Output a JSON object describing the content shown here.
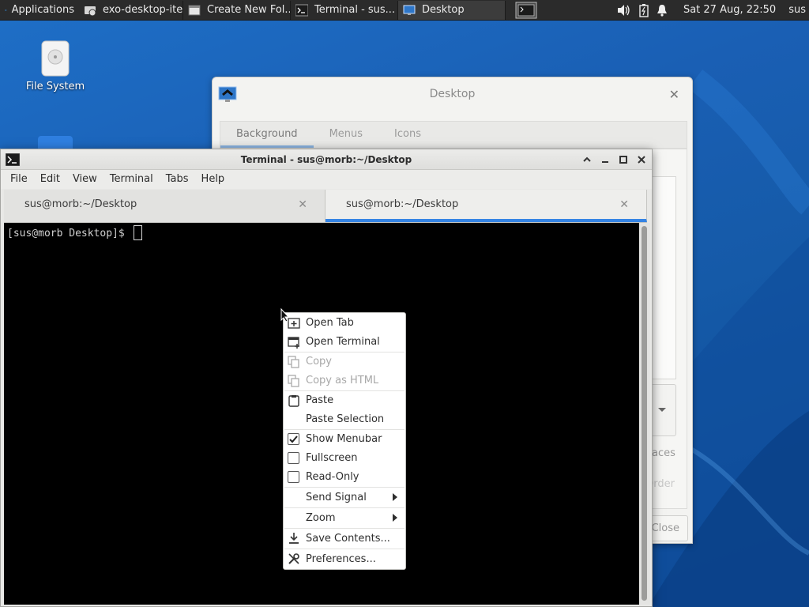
{
  "panel": {
    "applications_label": "Applications",
    "tasks": [
      {
        "label": "exo-desktop-ite...",
        "icon": "file-manager-icon"
      },
      {
        "label": "Create New Fol...",
        "icon": "folder-window-icon"
      },
      {
        "label": "Terminal - sus...",
        "icon": "terminal-icon"
      },
      {
        "label": "Desktop",
        "icon": "desktop-settings-icon"
      }
    ],
    "clock": "Sat 27 Aug, 22:50",
    "user": "sus"
  },
  "desktop": {
    "icons": [
      {
        "label": "File System",
        "icon": "drive-icon"
      }
    ]
  },
  "desktop_dialog": {
    "title": "Desktop",
    "tabs": [
      "Background",
      "Menus",
      "Icons"
    ],
    "partial_labels": {
      "aces": "aces",
      "order": "Order",
      "close": "Close"
    }
  },
  "terminal": {
    "title": "Terminal - sus@morb:~/Desktop",
    "menu": [
      "File",
      "Edit",
      "View",
      "Terminal",
      "Tabs",
      "Help"
    ],
    "tabs": [
      {
        "label": "sus@morb:~/Desktop",
        "active": false
      },
      {
        "label": "sus@morb:~/Desktop",
        "active": true
      }
    ],
    "prompt": "[sus@morb Desktop]$ "
  },
  "context_menu": {
    "items": [
      {
        "label": "Open Tab",
        "icon": "open-tab-icon",
        "enabled": true
      },
      {
        "label": "Open Terminal",
        "icon": "open-terminal-icon",
        "enabled": true
      },
      {
        "label": "Copy",
        "icon": "copy-icon",
        "enabled": false
      },
      {
        "label": "Copy as HTML",
        "icon": "copy-html-icon",
        "enabled": false
      },
      {
        "label": "Paste",
        "icon": "paste-icon",
        "enabled": true
      },
      {
        "label": "Paste Selection",
        "icon": "",
        "enabled": true
      },
      {
        "label": "Show Menubar",
        "checked": true
      },
      {
        "label": "Fullscreen",
        "checked": false
      },
      {
        "label": "Read-Only",
        "checked": false
      },
      {
        "label": "Send Signal",
        "submenu": true
      },
      {
        "label": "Zoom",
        "submenu": true
      },
      {
        "label": "Save Contents...",
        "icon": "save-icon",
        "enabled": true
      },
      {
        "label": "Preferences...",
        "icon": "preferences-icon",
        "enabled": true
      }
    ]
  },
  "colors": {
    "accent": "#3584e4",
    "terminal_bg": "#000000",
    "desktop_bg": "#1a5fb4"
  }
}
